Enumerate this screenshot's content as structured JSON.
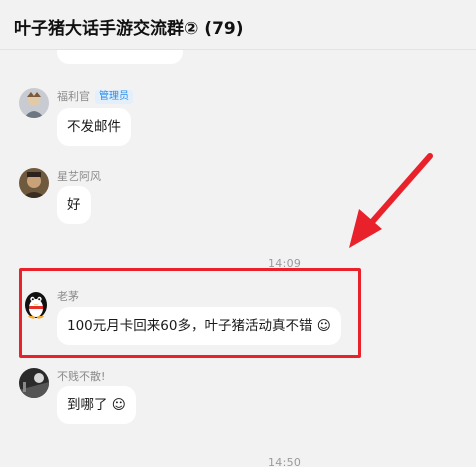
{
  "header": {
    "title": "叶子猪大话手游交流群② (79)"
  },
  "messages": [
    {
      "sender": "福利官",
      "badge": "管理员",
      "text": "不发邮件"
    },
    {
      "sender": "星艺阿风",
      "text": "好"
    },
    {
      "sender": "老茅",
      "text": "100元月卡回来60多，叶子猪活动真不错 ☺"
    },
    {
      "sender": "不贱不散!",
      "text": "到哪了 ☺"
    }
  ],
  "times": [
    "14:09",
    "14:50"
  ],
  "colors": {
    "background": "#f2f2f2",
    "bubble": "#ffffff",
    "admin_badge": "#2a8bea",
    "annotation_red": "#e8212b"
  }
}
